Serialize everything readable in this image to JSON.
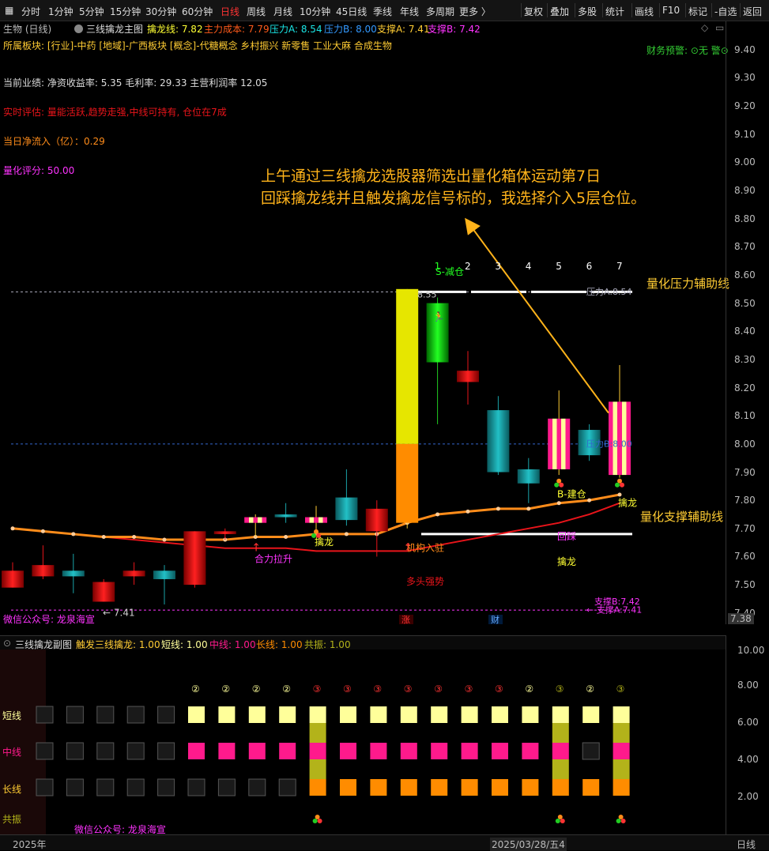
{
  "toolbar": {
    "left": [
      "分时",
      "1分钟",
      "5分钟",
      "15分钟",
      "30分钟",
      "60分钟",
      "日线",
      "周线",
      "月线",
      "10分钟",
      "45日线",
      "季线",
      "年线",
      "多周期",
      "更多 〉"
    ],
    "active": "日线",
    "right": [
      "复权",
      "叠加",
      "多股",
      "统计",
      "画线",
      "F10",
      "标记",
      "-自选",
      "返回"
    ]
  },
  "info": {
    "stock": "生物 (日线)",
    "indicator": "三线擒龙主图",
    "qinlong": "擒龙线: 7.82",
    "cost": "主力成本: 7.79",
    "pa": "压力A: 8.54",
    "pb": "压力B: 8.00",
    "sa": "支撑A: 7.41",
    "sb": "支撑B: 7.42"
  },
  "panel": {
    "sector": "所属板块: [行业]-中药 [地域]-广西板块 [概念]-代糖概念 乡村振兴 新零售 工业大麻 合成生物",
    "warning": "财务预警: ⊙无 警⊙",
    "perf": "当前业绩:  净资收益率: 5.35  毛利率: 29.33  主营利润率 12.05",
    "eval": "实时评估:  量能活跃,趋势走强,中线可持有,  仓位在7成",
    "inflow": "当日净流入（亿）：0.29",
    "score": "量化评分:  50.00",
    "wechat": "微信公众号:  龙泉海宣"
  },
  "annotation": {
    "line1": "上午通过三线擒龙选股器筛选出量化箱体运动第7日",
    "line2": "回踩擒龙线并且触发擒龙信号标的，我选择介入5层仓位。"
  },
  "chart_labels": {
    "pressure_aux": "量化压力辅助线",
    "support_aux": "量化支撑辅助线",
    "peak": "8.55",
    "low": "← 7.41",
    "jianchang": "S-减仓",
    "pa_line": "压力A:8.54",
    "pb_line": "压力B:8.00",
    "sa_line": "← 支撑A:7.41",
    "sb_line": "支撑B:7.42",
    "heli": "合力拉升",
    "qinlong1": "擒龙",
    "jigou": "机构入驻",
    "duotou": "多头强势",
    "jiancang": "B-建仓",
    "huicai": "回踩",
    "qinlong2": "擒龙",
    "qinlong3": "擒龙",
    "zhang": "涨",
    "cai": "财",
    "last_price": "7.38",
    "days": [
      "1",
      "2",
      "3",
      "4",
      "5",
      "6",
      "7"
    ]
  },
  "price_ticks": [
    "9.40",
    "9.30",
    "9.20",
    "9.10",
    "9.00",
    "8.90",
    "8.80",
    "8.70",
    "8.60",
    "8.50",
    "8.40",
    "8.30",
    "8.20",
    "8.10",
    "8.00",
    "7.90",
    "7.80",
    "7.70",
    "7.60",
    "7.50",
    "7.40"
  ],
  "sub": {
    "title": "三线擒龙副图",
    "trigger": "触发三线擒龙: 1.00",
    "short": "短线: 1.00",
    "mid": "中线: 1.00",
    "long": "长线: 1.00",
    "resonance": "共振: 1.00",
    "row_short": "短线",
    "row_mid": "中线",
    "row_long": "长线",
    "row_res": "共振",
    "wechat": "微信公众号:  龙泉海宣",
    "ticks": [
      "10.00",
      "8.00",
      "6.00",
      "4.00",
      "2.00"
    ],
    "circles": [
      "②",
      "②",
      "②",
      "②",
      "③",
      "③",
      "③",
      "③",
      "③",
      "③",
      "③",
      "②",
      "③",
      "②",
      "③"
    ]
  },
  "bottom": {
    "year": "2025年",
    "date": "2025/03/28/五4",
    "period": "日线"
  },
  "colors": {
    "up": "#e8141a",
    "down": "#1aa3a8",
    "yellow": "#ffff9a",
    "pink": "#ff1a8c",
    "orange": "#ff8c00",
    "olive": "#b3b31a"
  },
  "chart_data": {
    "type": "candlestick",
    "ylim": [
      7.36,
      9.45
    ],
    "candles": [
      {
        "o": 7.55,
        "h": 7.58,
        "l": 7.49,
        "c": 7.49,
        "color": "up"
      },
      {
        "o": 7.57,
        "h": 7.64,
        "l": 7.52,
        "c": 7.53,
        "color": "up"
      },
      {
        "o": 7.53,
        "h": 7.61,
        "l": 7.47,
        "c": 7.55,
        "color": "down"
      },
      {
        "o": 7.51,
        "h": 7.52,
        "l": 7.44,
        "c": 7.44,
        "color": "up"
      },
      {
        "o": 7.55,
        "h": 7.58,
        "l": 7.5,
        "c": 7.53,
        "color": "up"
      },
      {
        "o": 7.55,
        "h": 7.57,
        "l": 7.43,
        "c": 7.52,
        "color": "down"
      },
      {
        "o": 7.5,
        "h": 7.69,
        "l": 7.49,
        "c": 7.69,
        "color": "up"
      },
      {
        "o": 7.68,
        "h": 7.7,
        "l": 7.66,
        "c": 7.69,
        "color": "up"
      },
      {
        "o": 7.72,
        "h": 7.75,
        "l": 7.67,
        "c": 7.74,
        "color": "yellow"
      },
      {
        "o": 7.74,
        "h": 7.79,
        "l": 7.72,
        "c": 7.75,
        "color": "down"
      },
      {
        "o": 7.72,
        "h": 7.78,
        "l": 7.68,
        "c": 7.74,
        "color": "yellow"
      },
      {
        "o": 7.73,
        "h": 7.91,
        "l": 7.71,
        "c": 7.81,
        "color": "down"
      },
      {
        "o": 7.69,
        "h": 7.8,
        "l": 7.6,
        "c": 7.77,
        "color": "up"
      },
      {
        "o": 7.72,
        "h": 8.55,
        "l": 7.7,
        "c": 8.55,
        "color": "bigyellow"
      },
      {
        "o": 8.5,
        "h": 8.52,
        "l": 8.07,
        "c": 8.29,
        "color": "green"
      },
      {
        "o": 8.26,
        "h": 8.33,
        "l": 8.14,
        "c": 8.22,
        "color": "up"
      },
      {
        "o": 8.12,
        "h": 8.17,
        "l": 7.89,
        "c": 7.9,
        "color": "down"
      },
      {
        "o": 7.91,
        "h": 7.95,
        "l": 7.79,
        "c": 7.86,
        "color": "down"
      },
      {
        "o": 8.09,
        "h": 8.19,
        "l": 7.89,
        "c": 7.91,
        "color": "yellow"
      },
      {
        "o": 8.05,
        "h": 8.07,
        "l": 7.94,
        "c": 7.96,
        "color": "down"
      },
      {
        "o": 8.15,
        "h": 8.28,
        "l": 7.88,
        "c": 7.89,
        "color": "yellow"
      }
    ],
    "qinlong_line": [
      7.7,
      7.69,
      7.68,
      7.67,
      7.67,
      7.66,
      7.66,
      7.66,
      7.67,
      7.67,
      7.68,
      7.68,
      7.68,
      7.72,
      7.75,
      7.76,
      7.77,
      7.77,
      7.79,
      7.8,
      7.82
    ],
    "cost_line": [
      7.7,
      7.69,
      7.68,
      7.67,
      7.66,
      7.65,
      7.64,
      7.63,
      7.63,
      7.63,
      7.62,
      7.62,
      7.62,
      7.62,
      7.64,
      7.66,
      7.68,
      7.7,
      7.72,
      7.75,
      7.79
    ],
    "pressure_a": 8.54,
    "pressure_b": 8.0,
    "support_a": 7.41,
    "support_line": 7.68
  }
}
